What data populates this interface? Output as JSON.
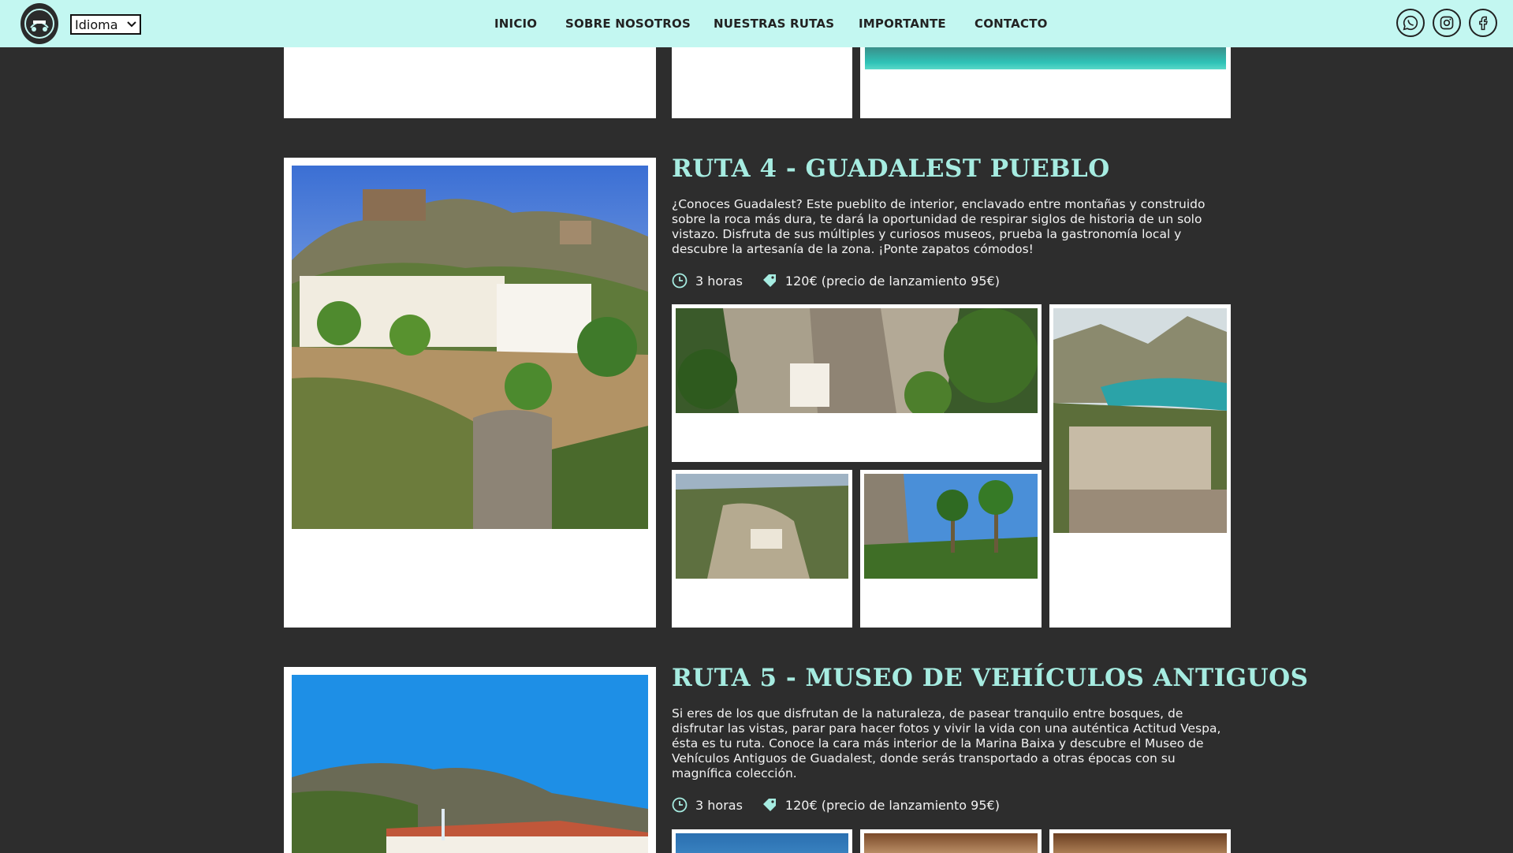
{
  "header": {
    "language_select": "Idioma",
    "nav": [
      "INICIO",
      "SOBRE NOSOTROS",
      "NUESTRAS RUTAS",
      "IMPORTANTE",
      "CONTACTO"
    ],
    "social": [
      "whatsapp-icon",
      "instagram-icon",
      "facebook-icon"
    ]
  },
  "routes": [
    {
      "title": "RUTA 4 - GUADALEST PUEBLO",
      "description": "¿Conoces Guadalest? Este pueblito de interior, enclavado entre montañas y construido sobre la roca más dura, te dará la oportunidad de respirar siglos de historia de un solo vistazo. Disfruta de sus múltiples y curiosos museos, prueba la gastronomía local y descubre la artesanía de la zona. ¡Ponte zapatos cómodos!",
      "duration": "3 horas",
      "price": "120€ (precio de lanzamiento 95€)"
    },
    {
      "title": "RUTA 5 - MUSEO DE VEHÍCULOS ANTIGUOS",
      "description": "Si eres de los que disfrutan de la naturaleza, de pasear tranquilo entre bosques, de disfrutar las vistas, parar para hacer fotos y vivir la vida con una auténtica Actitud Vespa, ésta es tu ruta. Conoce la cara más interior de la Marina Baixa y descubre el Museo de Vehículos Antiguos de Guadalest, donde serás transportado a otras épocas con su magnífica colección.",
      "duration": "3 horas",
      "price": "120€ (precio de lanzamiento 95€)"
    }
  ],
  "colors": {
    "header_bg": "#c3f7f1",
    "page_bg": "#2d2d2d",
    "title": "#a6ece1"
  }
}
